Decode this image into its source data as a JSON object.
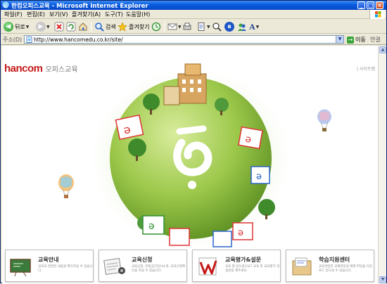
{
  "window": {
    "title": "한컴오피스교육 - Microsoft Internet Explorer"
  },
  "menu": [
    {
      "label": "파일(F)"
    },
    {
      "label": "편집(E)"
    },
    {
      "label": "보기(V)"
    },
    {
      "label": "즐겨찾기(A)"
    },
    {
      "label": "도구(T)"
    },
    {
      "label": "도움말(H)"
    }
  ],
  "toolbar": {
    "back_label": "뒤로",
    "search_label": "검색",
    "favorites_label": "즐겨찾기"
  },
  "address": {
    "label": "주소(D)",
    "url": "http://www.hancomedu.co.kr/site/",
    "go_label": "이동",
    "links_label": "연결"
  },
  "page": {
    "logo_brand": "hancom",
    "logo_text": "오피스교육",
    "sitemap_label": "| 사이트맵",
    "cards": [
      {
        "title": "교육안내",
        "desc": "교육과 관련된 내용을 확인하실 수 있습니다.",
        "icon": "chalkboard-icon"
      },
      {
        "title": "교육신청",
        "desc": "교육신청, 한컴공인강사소개, 교육신청확인을 하실 수 있습니다.",
        "icon": "calendar-icon"
      },
      {
        "title": "교육평가&설문",
        "desc": "교육 잘 받으셨나요? 교육 후 교육평가 및 설문을 해주세요.",
        "icon": "checklist-icon"
      },
      {
        "title": "학습지원센터",
        "desc": "교육관련한 교재파일과 예제 파일을 다운로드 받으실 수 있습니다.",
        "icon": "folder-icon"
      }
    ]
  },
  "colors": {
    "title_bar": "#0a5ce0",
    "brand_red": "#c41a1a",
    "planet_green": "#8cbf3a"
  }
}
